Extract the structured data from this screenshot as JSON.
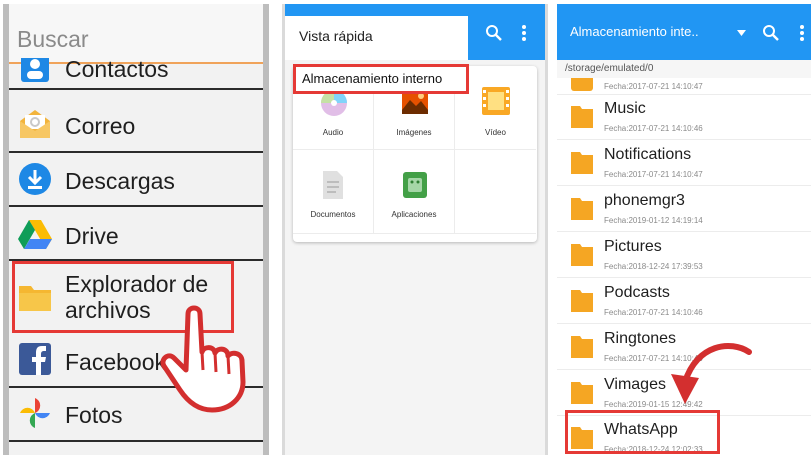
{
  "panel1": {
    "search_placeholder": "Buscar",
    "items": [
      {
        "label": "Contactos",
        "icon": "contacts-icon"
      },
      {
        "label": "Correo",
        "icon": "mail-icon"
      },
      {
        "label": "Descargas",
        "icon": "download-icon"
      },
      {
        "label": "Drive",
        "icon": "drive-icon"
      },
      {
        "label": "Explorador de\narchivos",
        "icon": "folder-icon",
        "highlighted": true
      },
      {
        "label": "Facebook",
        "icon": "facebook-icon"
      },
      {
        "label": "Fotos",
        "icon": "photos-icon"
      }
    ]
  },
  "panel2": {
    "tab_label": "Vista rápida",
    "highlight_label": "Almacenamiento interno",
    "tiles": [
      {
        "label": "Audio",
        "icon": "audio-icon"
      },
      {
        "label": "Imágenes",
        "icon": "images-icon"
      },
      {
        "label": "Vídeo",
        "icon": "video-icon"
      },
      {
        "label": "Documentos",
        "icon": "document-icon"
      },
      {
        "label": "Aplicaciones",
        "icon": "android-icon"
      }
    ]
  },
  "panel3": {
    "title": "Almacenamiento inte..",
    "path": "/storage/emulated/0",
    "first_date": "Fecha:2017-07-21 14:10:47",
    "folders": [
      {
        "name": "Music",
        "date": "Fecha:2017-07-21 14:10:46"
      },
      {
        "name": "Notifications",
        "date": "Fecha:2017-07-21 14:10:47"
      },
      {
        "name": "phonemgr3",
        "date": "Fecha:2019-01-12 14:19:14"
      },
      {
        "name": "Pictures",
        "date": "Fecha:2018-12-24 17:39:53"
      },
      {
        "name": "Podcasts",
        "date": "Fecha:2017-07-21 14:10:46"
      },
      {
        "name": "Ringtones",
        "date": "Fecha:2017-07-21 14:10:46"
      },
      {
        "name": "Vimages",
        "date": "Fecha:2019-01-15 12:49:42"
      },
      {
        "name": "WhatsApp",
        "date": "Fecha:2018-12-24 12:02:33",
        "highlighted": true
      }
    ]
  },
  "colors": {
    "accent": "#2196f3",
    "highlight": "#e53935",
    "folder": "#f5a623"
  }
}
